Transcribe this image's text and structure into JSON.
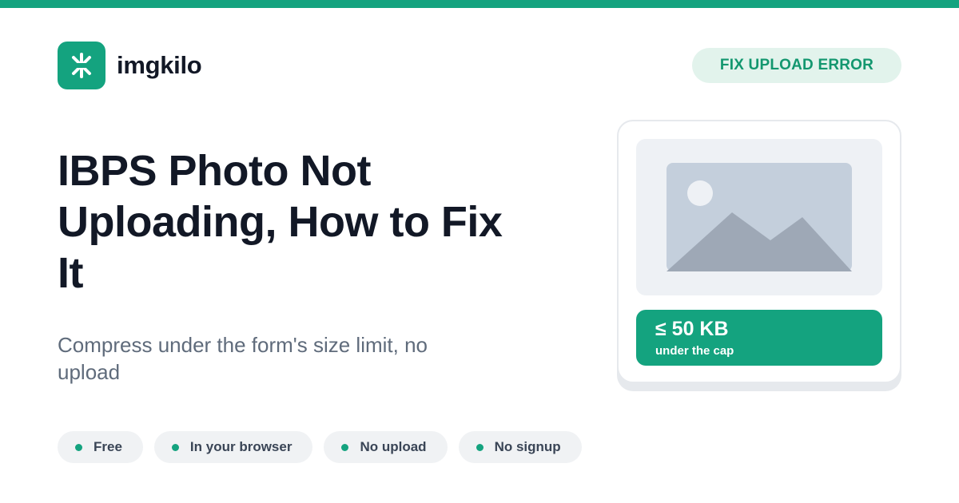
{
  "brand": {
    "name": "imgkilo",
    "logo_icon": "asterisk-spark-icon"
  },
  "badge": {
    "label": "FIX UPLOAD ERROR"
  },
  "headline": "IBPS Photo Not Uploading, How to Fix It",
  "subtitle": "Compress under the form's size limit, no upload",
  "features": [
    {
      "label": "Free"
    },
    {
      "label": "In your browser"
    },
    {
      "label": "No upload"
    },
    {
      "label": "No signup"
    }
  ],
  "preview_card": {
    "image_icon": "image-placeholder-icon",
    "size_value": "≤ 50 KB",
    "size_caption": "under the cap"
  },
  "colors": {
    "accent": "#14a37f",
    "accent_light": "#e2f3ec",
    "heading": "#121826",
    "body_text": "#5f6b7b",
    "chip_bg": "#f0f2f4"
  }
}
